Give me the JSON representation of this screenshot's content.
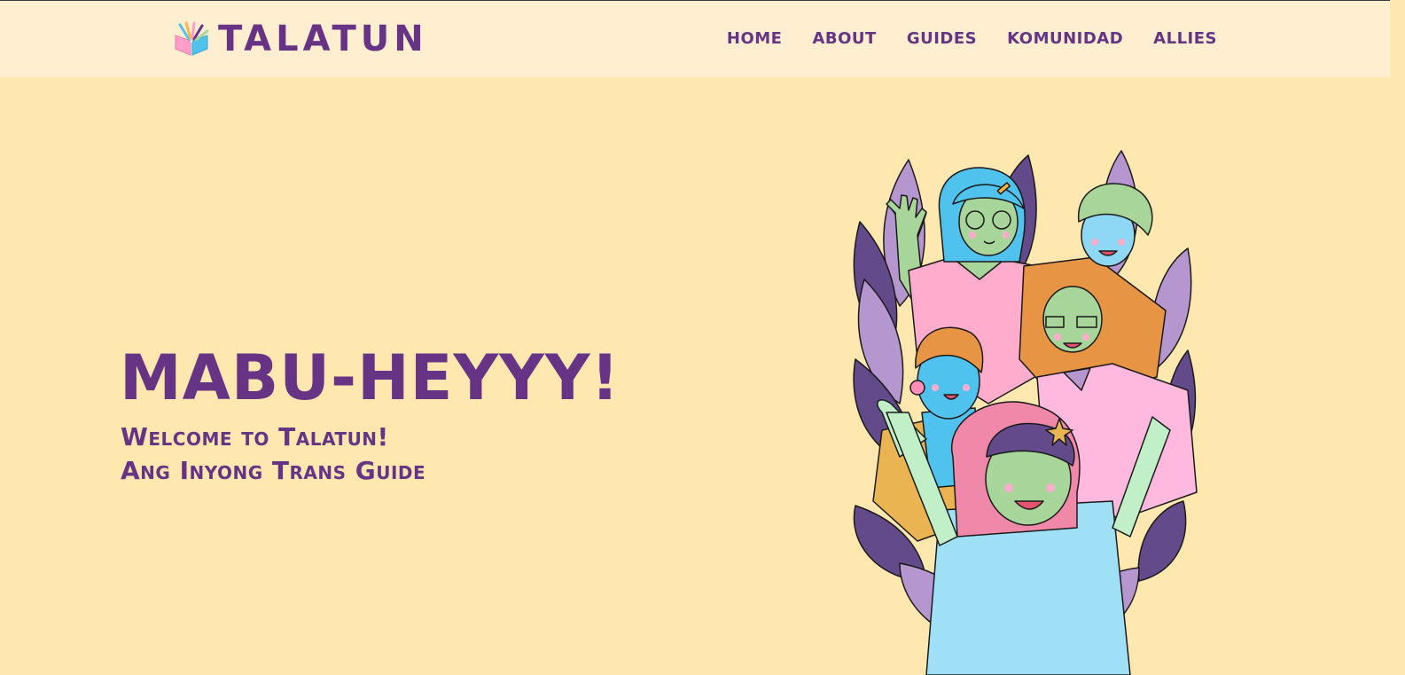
{
  "brand": {
    "name": "TALATUN",
    "logo_icon": "open-book-icon"
  },
  "nav": {
    "items": [
      {
        "label": "HOME"
      },
      {
        "label": "ABOUT"
      },
      {
        "label": "GUIDES"
      },
      {
        "label": "KOMUNIDAD"
      },
      {
        "label": "ALLIES"
      }
    ]
  },
  "hero": {
    "title": "MABU-HEYYY!",
    "subtitle_line1": "Welcome to Talatun!",
    "subtitle_line2": "Ang Inyong Trans Guide",
    "illustration": "group-of-friends-illustration"
  },
  "colors": {
    "background": "#FFE8B0",
    "header_bg": "#FFEED0",
    "accent_purple": "#663385",
    "leaf_light": "#B596CF",
    "leaf_dark": "#634A8A",
    "pink": "#FFACCD",
    "orange": "#E89445",
    "blue": "#4FC3EE",
    "green": "#A8D59A"
  }
}
